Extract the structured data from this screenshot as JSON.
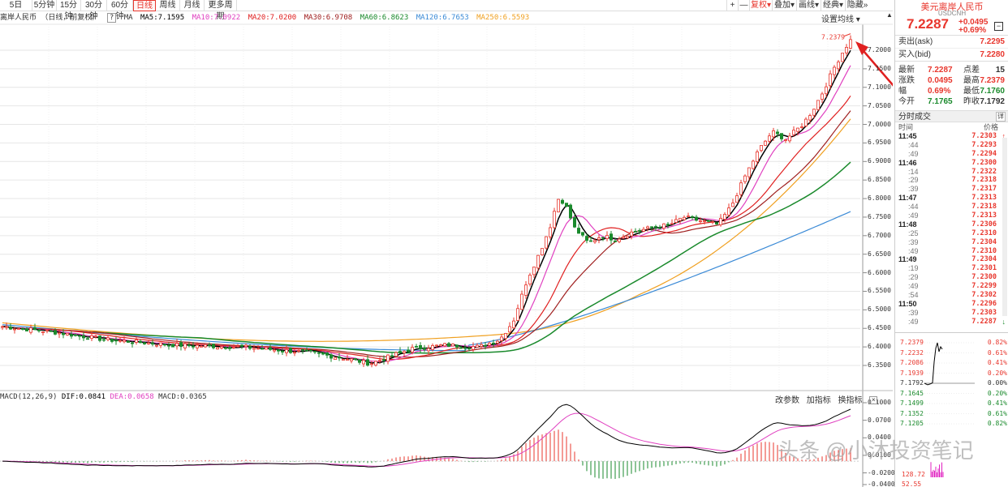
{
  "toolbar": {
    "periods": [
      "5日",
      "5分钟",
      "15分钟",
      "30分钟",
      "60分钟",
      "日线",
      "周线",
      "月线",
      "更多周期"
    ],
    "active_period": "日线",
    "tools": [
      "+",
      "—",
      "复权",
      "叠加",
      "画线",
      "经典",
      "隐藏"
    ]
  },
  "ma_legend": {
    "title": "离岸人民币 （日线，前复权）",
    "ma5": "MA5:7.1595",
    "ma10": "MA10:7.0922",
    "ma20": "MA20:7.0200",
    "ma30": "MA30:6.9708",
    "ma60": "MA60:6.8623",
    "ma120": "MA120:6.7653",
    "ma250": "MA250:6.5593",
    "colors": {
      "ma5": "#000000",
      "ma10": "#e040c0",
      "ma20": "#e02020",
      "ma30": "#a02020",
      "ma60": "#1a8a2c",
      "ma120": "#3a8ad6",
      "ma250": "#f0a020"
    }
  },
  "settings_label": "设置均线",
  "price_axis": [
    "7.2000",
    "7.1500",
    "7.1000",
    "7.0500",
    "7.0000",
    "6.9500",
    "6.9000",
    "6.8500",
    "6.8000",
    "6.7500",
    "6.7000",
    "6.6500",
    "6.6000",
    "6.5500",
    "6.5000",
    "6.4500",
    "6.4000",
    "6.3500"
  ],
  "high_marker": "7.2379",
  "macd": {
    "title": "MACD(12,26,9)",
    "dif": "DIF:0.0841",
    "dea": "DEA:0.0658",
    "macd": "MACD:0.0365",
    "tools": [
      "改参数",
      "加指标",
      "换指标"
    ],
    "axis": [
      "0.1000",
      "0.0700",
      "0.0400",
      "0.0100",
      "-0.0200",
      "-0.0400"
    ]
  },
  "panel": {
    "name": "美元离岸人民币",
    "code": "USDCNH",
    "last": "7.2287",
    "change_abs": "+0.0495",
    "change_pct": "+0.69%",
    "ask_label": "卖出(ask)",
    "ask": "7.2295",
    "bid_label": "买入(bid)",
    "bid": "7.2280",
    "stats": [
      {
        "l1": "最新",
        "v1": "7.2287",
        "c1": "red",
        "l2": "点差",
        "v2": "15",
        "c2": "black"
      },
      {
        "l1": "涨跌",
        "v1": "0.0495",
        "c1": "red",
        "l2": "最高",
        "v2": "7.2379",
        "c2": "red"
      },
      {
        "l1": "幅",
        "v1": "0.69%",
        "c1": "red",
        "l2": "最低",
        "v2": "7.1760",
        "c2": "green"
      },
      {
        "l1": "今开",
        "v1": "7.1765",
        "c1": "green",
        "l2": "昨收",
        "v2": "7.1792",
        "c2": "black"
      }
    ],
    "ticks_title": "分时成交",
    "ticks_detail": "详",
    "col_time": "时间",
    "col_price": "价格",
    "ticks": [
      {
        "t": "11:45",
        "p": "7.2303",
        "d": "up"
      },
      {
        "t": ":44",
        "p": "7.2293",
        "d": "down"
      },
      {
        "t": ":49",
        "p": "7.2294",
        "d": "up"
      },
      {
        "t": "11:46",
        "p": "7.2300",
        "d": "up"
      },
      {
        "t": ":14",
        "p": "7.2322",
        "d": "up"
      },
      {
        "t": ":29",
        "p": "7.2318",
        "d": "down"
      },
      {
        "t": ":39",
        "p": "7.2317",
        "d": "down"
      },
      {
        "t": "11:47",
        "p": "7.2313",
        "d": "down"
      },
      {
        "t": ":44",
        "p": "7.2318",
        "d": "up"
      },
      {
        "t": ":49",
        "p": "7.2313",
        "d": "down"
      },
      {
        "t": "11:48",
        "p": "7.2306",
        "d": "down"
      },
      {
        "t": ":25",
        "p": "7.2310",
        "d": "up"
      },
      {
        "t": ":39",
        "p": "7.2304",
        "d": "down"
      },
      {
        "t": ":49",
        "p": "7.2310",
        "d": "up"
      },
      {
        "t": "11:49",
        "p": "7.2304",
        "d": "down"
      },
      {
        "t": ":19",
        "p": "7.2301",
        "d": "down"
      },
      {
        "t": ":29",
        "p": "7.2300",
        "d": "down"
      },
      {
        "t": ":49",
        "p": "7.2299",
        "d": "down"
      },
      {
        "t": ":54",
        "p": "7.2302",
        "d": "up"
      },
      {
        "t": "11:50",
        "p": "7.2296",
        "d": "down"
      },
      {
        "t": ":39",
        "p": "7.2303",
        "d": "up"
      },
      {
        "t": ":49",
        "p": "7.2287",
        "d": "down"
      }
    ],
    "mini_left": [
      "7.2379",
      "7.2232",
      "7.2086",
      "7.1939",
      "7.1792",
      "7.1645",
      "7.1499",
      "7.1352",
      "7.1205"
    ],
    "mini_right": [
      "0.82%",
      "0.61%",
      "0.41%",
      "0.20%",
      "0.00%",
      "0.20%",
      "0.41%",
      "0.61%",
      "0.82%"
    ],
    "mini_vol": [
      "128.72",
      "52.55"
    ]
  },
  "watermark": "头条 @小沐投资笔记"
}
